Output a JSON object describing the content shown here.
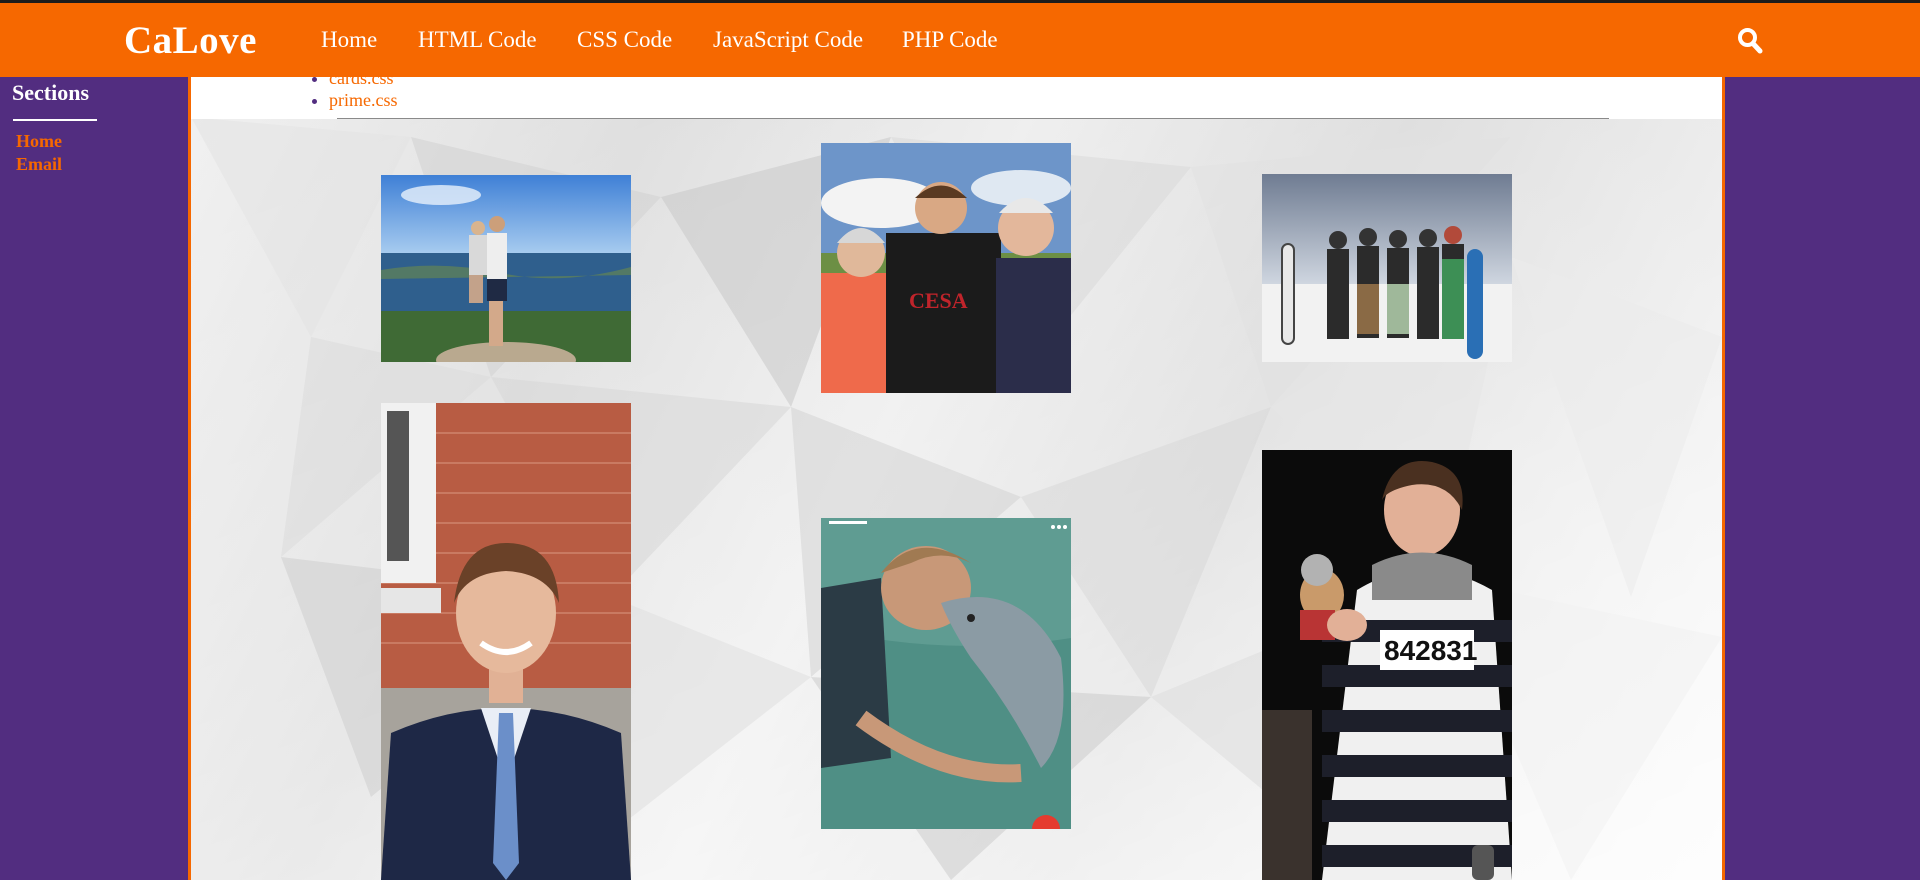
{
  "header": {
    "brand": "CaLove",
    "nav": [
      "Home",
      "HTML Code",
      "CSS Code",
      "JavaScript Code",
      "PHP Code"
    ],
    "search_icon": "search-icon"
  },
  "sidebar": {
    "title": "Sections",
    "links": [
      "Home",
      "Email"
    ]
  },
  "main": {
    "file_list": [
      "cards.css",
      "prime.css"
    ]
  },
  "colors": {
    "accent_orange": "#f66800",
    "brand_purple": "#522d80",
    "top_border": "#1c1c1c"
  }
}
